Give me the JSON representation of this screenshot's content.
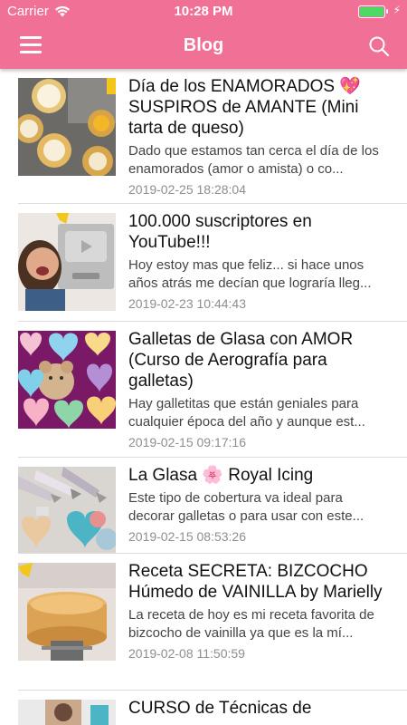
{
  "status": {
    "carrier": "Carrier",
    "time": "10:28 PM",
    "battery_level": 1.0
  },
  "header": {
    "title": "Blog"
  },
  "colors": {
    "accent": "#f07096",
    "text": "#111111",
    "excerpt": "#444444",
    "date": "#8e8e93"
  },
  "icons": {
    "menu": "hamburger-menu-icon",
    "search": "search-icon"
  },
  "posts": [
    {
      "title": "Día de los ENAMORADOS 💖 SUSPIROS de AMANTE (Mini tarta de queso)",
      "excerpt": "Dado que estamos tan cerca el día de los enamorados (amor o amista) o co...",
      "date": "2019-02-25 18:28:04",
      "thumb": "mini-cheesecakes-photo"
    },
    {
      "title": "100.000 suscriptores en YouTube!!!",
      "excerpt": "Hoy estoy mas que feliz... si hace unos años atrás me decían que lograría lleg...",
      "date": "2019-02-23 10:44:43",
      "thumb": "youtube-award-photo"
    },
    {
      "title": "Galletas de Glasa con AMOR (Curso de Aerografía para galletas)",
      "excerpt": "  Hay galletitas que están geniales para cualquier época del año y aunque est...",
      "date": "2019-02-15 09:17:16",
      "thumb": "heart-cookies-photo"
    },
    {
      "title": "La Glasa 🌸 Royal Icing",
      "excerpt": "Este tipo de cobertura va ideal para decorar galletas o para usar con este...",
      "date": "2019-02-15 08:53:26",
      "thumb": "piping-bags-photo"
    },
    {
      "title": "Receta SECRETA: BIZCOCHO Húmedo de VAINILLA by Marielly",
      "excerpt": "La receta de hoy es mi receta favorita de bizcocho de vainilla ya que es la mí...",
      "date": "2019-02-08 11:50:59",
      "thumb": "vanilla-sponge-cake-photo"
    },
    {
      "title": "CURSO de Técnicas de",
      "excerpt": "",
      "date": "",
      "thumb": "course-photo"
    }
  ]
}
